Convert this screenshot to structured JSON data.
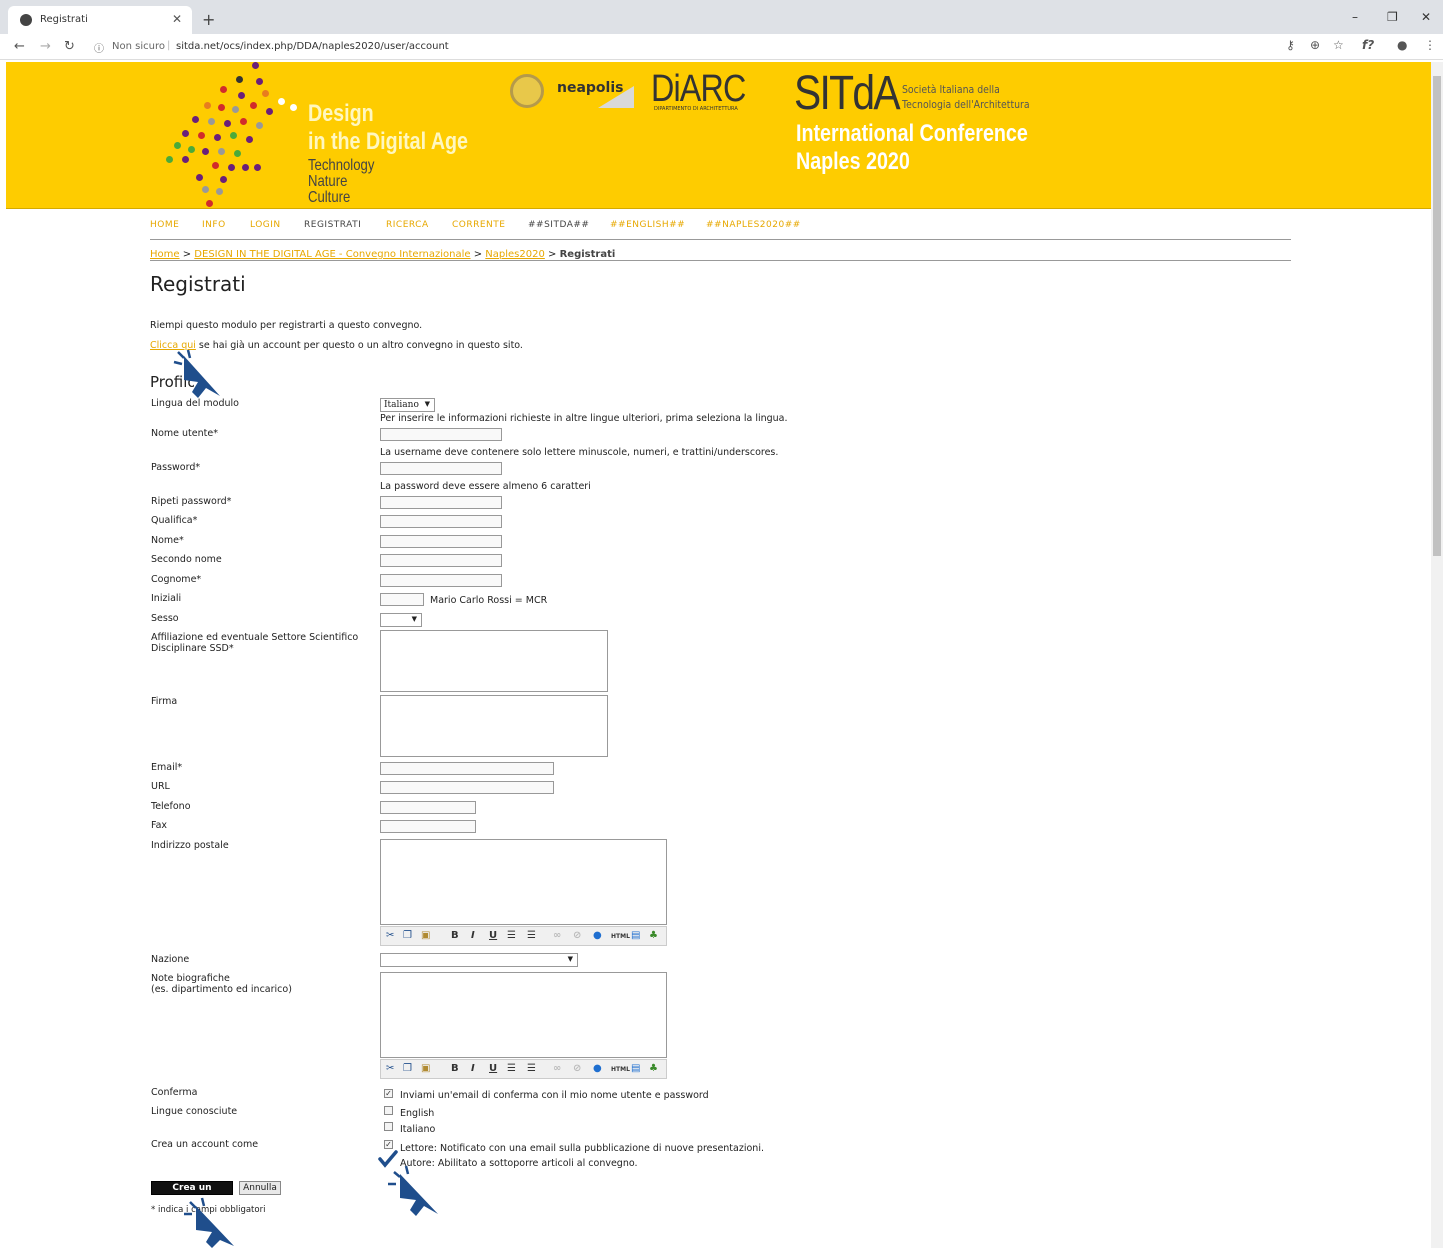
{
  "browser": {
    "tab_title": "Registrati",
    "not_secure": "Non sicuro",
    "url": "sitda.net/ocs/index.php/DDA/naples2020/user/account"
  },
  "header": {
    "design_lines": [
      "Design",
      "in the Digital Age"
    ],
    "tagline_lines": [
      "Technology",
      "Nature",
      "Culture"
    ],
    "neapolis": "neapolis",
    "diarc": "DiARC",
    "diarc_sub": "DIPARTIMENTO DI ARCHITETTURA",
    "sitda": "SITdA",
    "sitda_full_lines": [
      "Società Italiana della",
      "Tecnologia dell'Architettura"
    ],
    "conference_lines": [
      "International Conference",
      "Naples 2020"
    ]
  },
  "nav": {
    "items": [
      "HOME",
      "INFO",
      "LOGIN",
      "REGISTRATI",
      "RICERCA",
      "CORRENTE",
      "##SITDA##",
      "##ENGLISH##",
      "##NAPLES2020##"
    ]
  },
  "breadcrumb": {
    "home": "Home",
    "conference": "DESIGN IN THE DIGITAL AGE - Convegno Internazionale",
    "naples": "Naples2020",
    "current": "Registrati",
    "sep": ">"
  },
  "page": {
    "title": "Registrati",
    "intro": "Riempi questo modulo per registrarti a questo convegno.",
    "click_here": "Clicca qui",
    "click_here_rest": "se hai già un account per questo o un altro convegno in questo sito.",
    "profile_heading": "Profilo"
  },
  "form": {
    "lingua_label": "Lingua del modulo",
    "lingua_value": "Italiano",
    "lingua_hint": "Per inserire le informazioni richieste in altre lingue ulteriori, prima seleziona la lingua.",
    "username_label": "Nome utente*",
    "username_hint": "La username deve contenere solo lettere minuscole, numeri, e trattini/underscores.",
    "password_label": "Password*",
    "password_hint": "La password deve essere almeno 6 caratteri",
    "repeat_password_label": "Ripeti password*",
    "qualifica_label": "Qualifica*",
    "nome_label": "Nome*",
    "secondo_nome_label": "Secondo nome",
    "cognome_label": "Cognome*",
    "iniziali_label": "Iniziali",
    "iniziali_hint": "Mario Carlo Rossi = MCR",
    "sesso_label": "Sesso",
    "affiliazione_label_lines": [
      "Affiliazione   ed   eventuale   Settore   Scientifico",
      "Disciplinare SSD*"
    ],
    "firma_label": "Firma",
    "email_label": "Email*",
    "url_label": "URL",
    "telefono_label": "Telefono",
    "fax_label": "Fax",
    "indirizzo_label": "Indirizzo postale",
    "nazione_label": "Nazione",
    "note_label_lines": [
      "Note biografiche",
      "(es. dipartimento ed incarico)"
    ],
    "conferma_label": "Conferma",
    "conferma_text": "Inviami un'email di conferma con il mio nome utente e password",
    "lingue_label": "Lingue conosciute",
    "lang_english": "English",
    "lang_italiano": "Italiano",
    "crea_label": "Crea un account come",
    "role_lettore": "Lettore: Notificato con una email sulla pubblicazione di nuove presentazioni.",
    "role_autore": "Autore: Abilitato a sottoporre articoli al convegno.",
    "submit": "Crea un account",
    "cancel": "Annulla",
    "required_note": "* indica i campi obbligatori"
  },
  "colors": {
    "banner": "#fecc00",
    "link": "#e7a800",
    "cursor": "#1f4e8c"
  }
}
